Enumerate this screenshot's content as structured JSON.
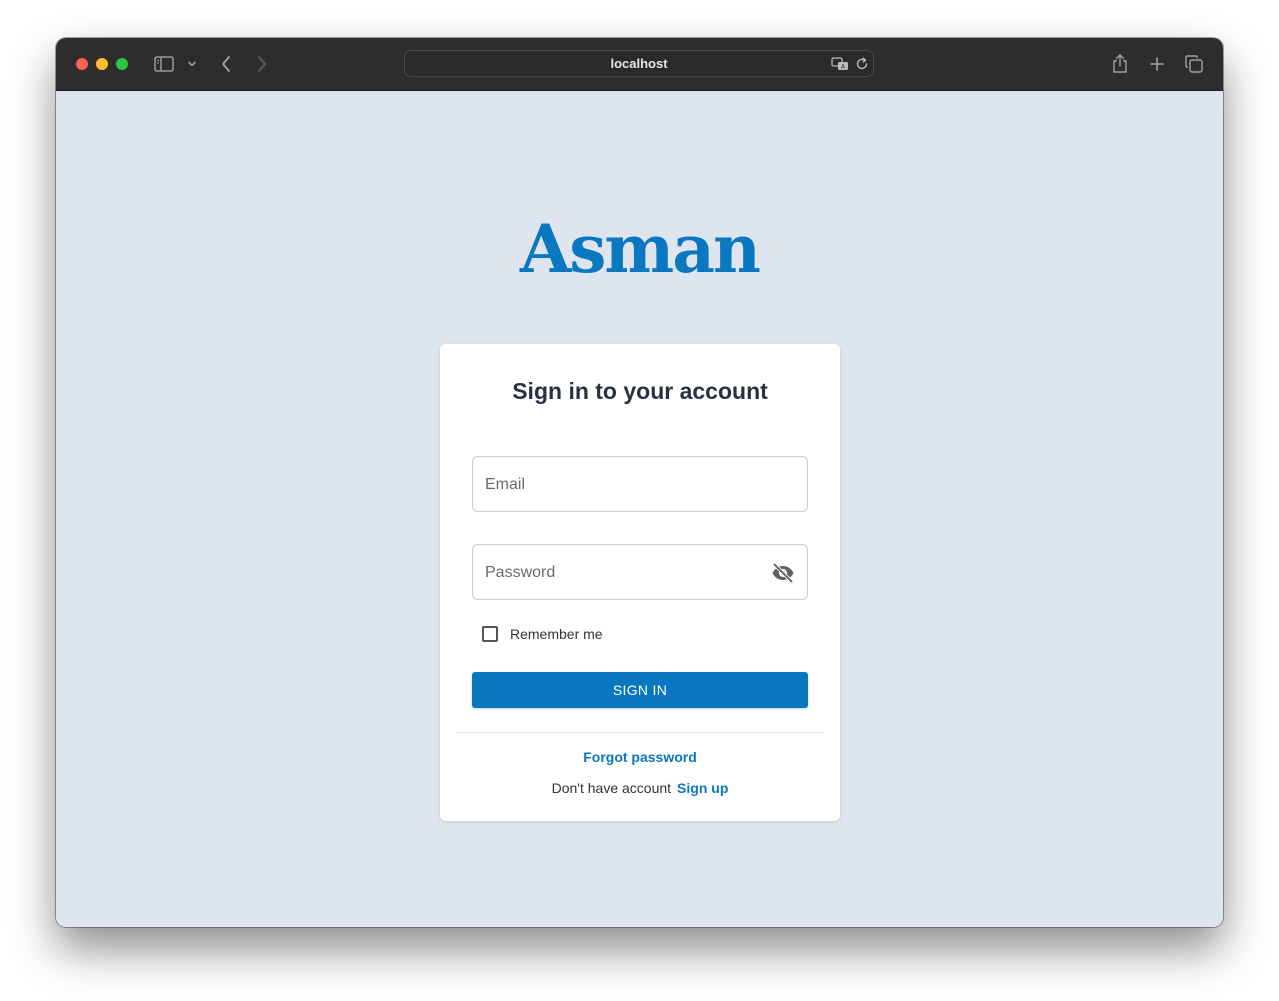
{
  "browser": {
    "url": "localhost",
    "icons": [
      "sidebar-icon",
      "chevron-down-icon",
      "back-icon",
      "forward-icon",
      "translate-icon",
      "reload-icon",
      "share-icon",
      "new-tab-icon",
      "tabs-overview-icon"
    ]
  },
  "app": {
    "logo_text": "Asman",
    "brand_color": "#0a78c1",
    "background_color": "#dfe5ee"
  },
  "login": {
    "title": "Sign in to your account",
    "email_placeholder": "Email",
    "password_placeholder": "Password",
    "remember_label": "Remember me",
    "remember_checked": false,
    "submit_label": "SIGN IN",
    "forgot_label": "Forgot password",
    "no_account_text": "Don't have account",
    "signup_label": "Sign up"
  }
}
